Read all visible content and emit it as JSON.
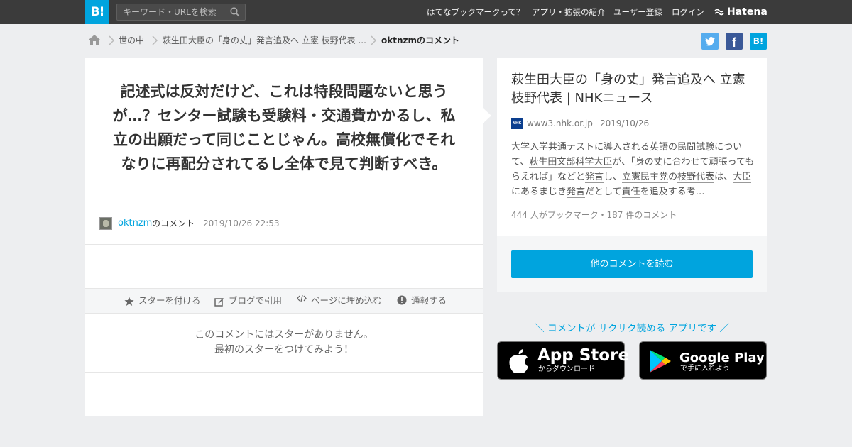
{
  "header": {
    "logo": "B!",
    "search_placeholder": "キーワード・URLを検索",
    "nav": [
      "はてなブックマークって？",
      "アプリ・拡張の紹介",
      "ユーザー登録",
      "ログイン"
    ],
    "brand": "Hatena"
  },
  "breadcrumb": [
    "世の中",
    "萩生田大臣の「身の丈」発言追及へ 立憲 枝野代表 ...",
    "oktnzmのコメント"
  ],
  "share": {
    "twitter": "t",
    "facebook": "f",
    "hatena": "B!"
  },
  "comment": {
    "text": "記述式は反対だけど、これは特段問題ないと思うが…？センター試験も受験料・交通費かかるし、私立の出願だって同じことじゃん。高校無償化でそれなりに再配分されてるし全体で見て判断すべき。",
    "user": "oktnzm",
    "user_suffix": "のコメント",
    "date": "2019/10/26 22:53"
  },
  "actions": [
    "スターを付ける",
    "ブログで引用",
    "ページに埋め込む",
    "通報する"
  ],
  "no_star": [
    "このコメントにはスターがありません。",
    "最初のスターをつけてみよう！"
  ],
  "entry": {
    "title": "萩生田大臣の「身の丈」発言追及へ 立憲 枝野代表 | NHKニュース",
    "domain": "www3.nhk.or.jp",
    "date": "2019/10/26",
    "icon_label": "NHK",
    "desc_parts": [
      {
        "t": "大学入学共通テスト",
        "k": true
      },
      {
        "t": "に導入される",
        "k": false
      },
      {
        "t": "英語",
        "k": true
      },
      {
        "t": "の",
        "k": false
      },
      {
        "t": "民間試験",
        "k": true
      },
      {
        "t": "について、",
        "k": false
      },
      {
        "t": "萩生田文部科学大臣",
        "k": true
      },
      {
        "t": "が、「身の丈に合わせて頑張ってもらえれば」などと",
        "k": false
      },
      {
        "t": "発言",
        "k": true
      },
      {
        "t": "し、",
        "k": false
      },
      {
        "t": "立憲民主党",
        "k": true
      },
      {
        "t": "の",
        "k": false
      },
      {
        "t": "枝野代表",
        "k": true
      },
      {
        "t": "は、",
        "k": false
      },
      {
        "t": "大臣",
        "k": true
      },
      {
        "t": "にあるまじき",
        "k": false
      },
      {
        "t": "発言",
        "k": true
      },
      {
        "t": "だとして",
        "k": false
      },
      {
        "t": "責任",
        "k": true
      },
      {
        "t": "を追及する考…",
        "k": false
      }
    ],
    "stats": "444 人がブックマーク・187 件のコメント",
    "read_button": "他のコメントを読む"
  },
  "app": {
    "promo": "＼ コメントが サクサク読める アプリです ／",
    "appstore_big": "App Store",
    "appstore_small": "からダウンロード",
    "googleplay_big": "Google Play",
    "googleplay_small": "で手に入れよう"
  },
  "colors": {
    "accent": "#00a4de",
    "topbar": "#3b3b3b",
    "twitter": "#55acee",
    "facebook": "#3b5998"
  }
}
